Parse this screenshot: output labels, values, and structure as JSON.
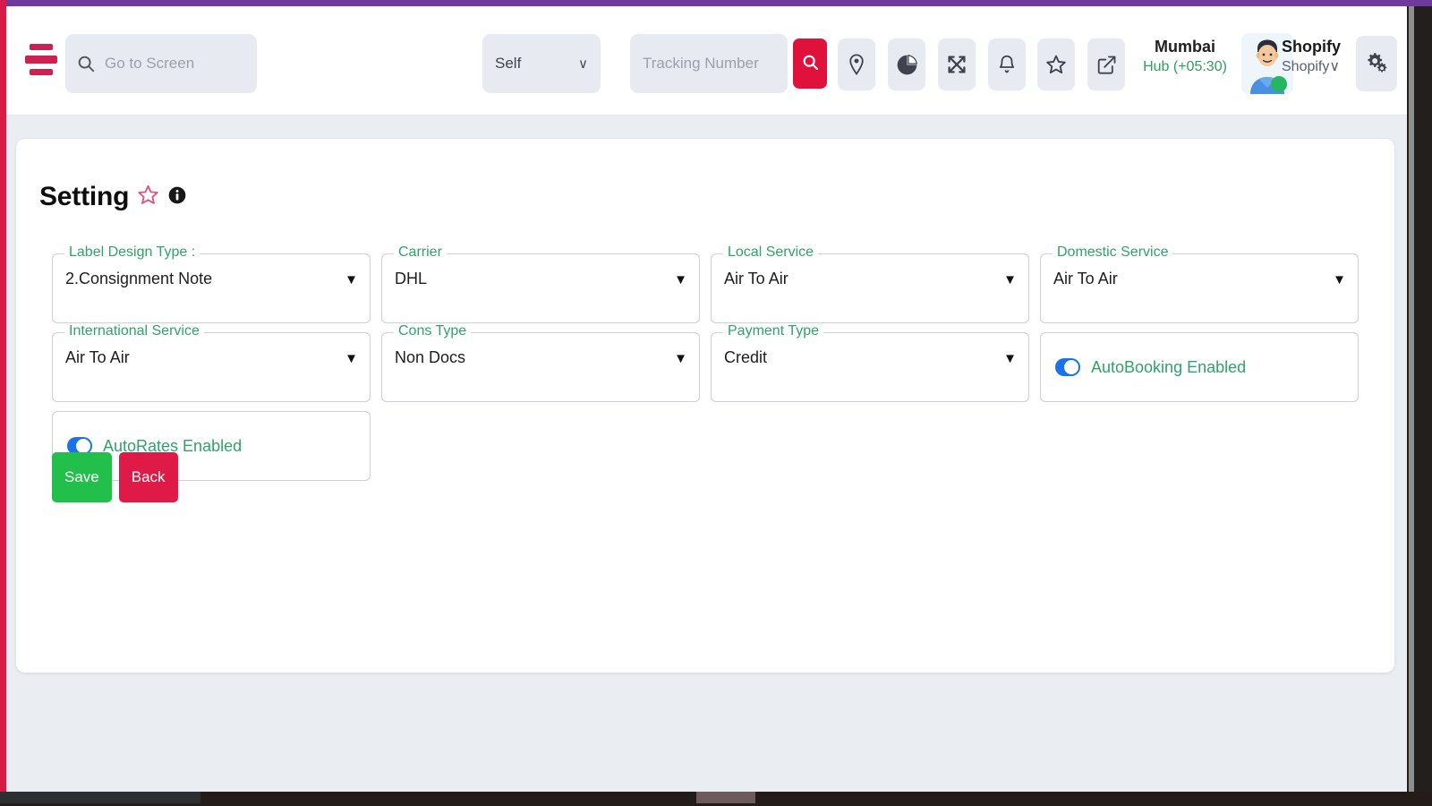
{
  "header": {
    "menu_icon": "hamburger-menu-icon",
    "goto": {
      "placeholder": "Go to Screen",
      "value": "",
      "icon": "search-icon"
    },
    "scope_select": {
      "value": "Self",
      "caret": "∨"
    },
    "tracking": {
      "placeholder": "Tracking Number",
      "value": ""
    },
    "search_button": {
      "icon": "search-icon",
      "color": "#e0123c"
    },
    "icons": [
      {
        "name": "location-pin-icon",
        "title": "Location"
      },
      {
        "name": "pie-chart-icon",
        "title": "Reports"
      },
      {
        "name": "shuffle-icon",
        "title": "Shuffle"
      },
      {
        "name": "bell-icon",
        "title": "Notifications"
      },
      {
        "name": "star-icon",
        "title": "Favourites"
      },
      {
        "name": "external-link-icon",
        "title": "Open"
      }
    ],
    "location": {
      "city": "Mumbai",
      "detail": "Hub (+05:30)"
    },
    "user": {
      "name": "Shopify",
      "sub": "Shopify∨",
      "avatar": "user-avatar"
    },
    "settings_icon": "gears-icon"
  },
  "page": {
    "title": "Setting",
    "title_icons": [
      "star-outline-icon",
      "info-icon"
    ]
  },
  "form": {
    "fields": [
      {
        "label": "Label Design Type :",
        "value": "2.Consignment Note",
        "type": "select"
      },
      {
        "label": "Carrier",
        "value": "DHL",
        "type": "select"
      },
      {
        "label": "Local Service",
        "value": "Air To Air",
        "type": "select"
      },
      {
        "label": "Domestic Service",
        "value": "Air To Air",
        "type": "select"
      },
      {
        "label": "International Service",
        "value": "Air To Air",
        "type": "select"
      },
      {
        "label": "Cons Type",
        "value": "Non Docs",
        "type": "select"
      },
      {
        "label": "Payment Type",
        "value": "Credit",
        "type": "select"
      },
      {
        "label": "",
        "value": "AutoBooking Enabled",
        "type": "toggle",
        "on": true
      },
      {
        "label": "",
        "value": "AutoRates Enabled",
        "type": "toggle",
        "on": true
      }
    ],
    "caret_glyph": "▼"
  },
  "actions": {
    "save_label": "Save",
    "back_label": "Back",
    "save_color": "#22c04b",
    "back_color": "#e01a46"
  },
  "theme": {
    "accent_top": "#6f3a9e",
    "accent_left": "#d81b45",
    "legend_green": "#2fa369",
    "toggle_blue": "#1a73ea",
    "page_bg": "#eaedf2"
  }
}
